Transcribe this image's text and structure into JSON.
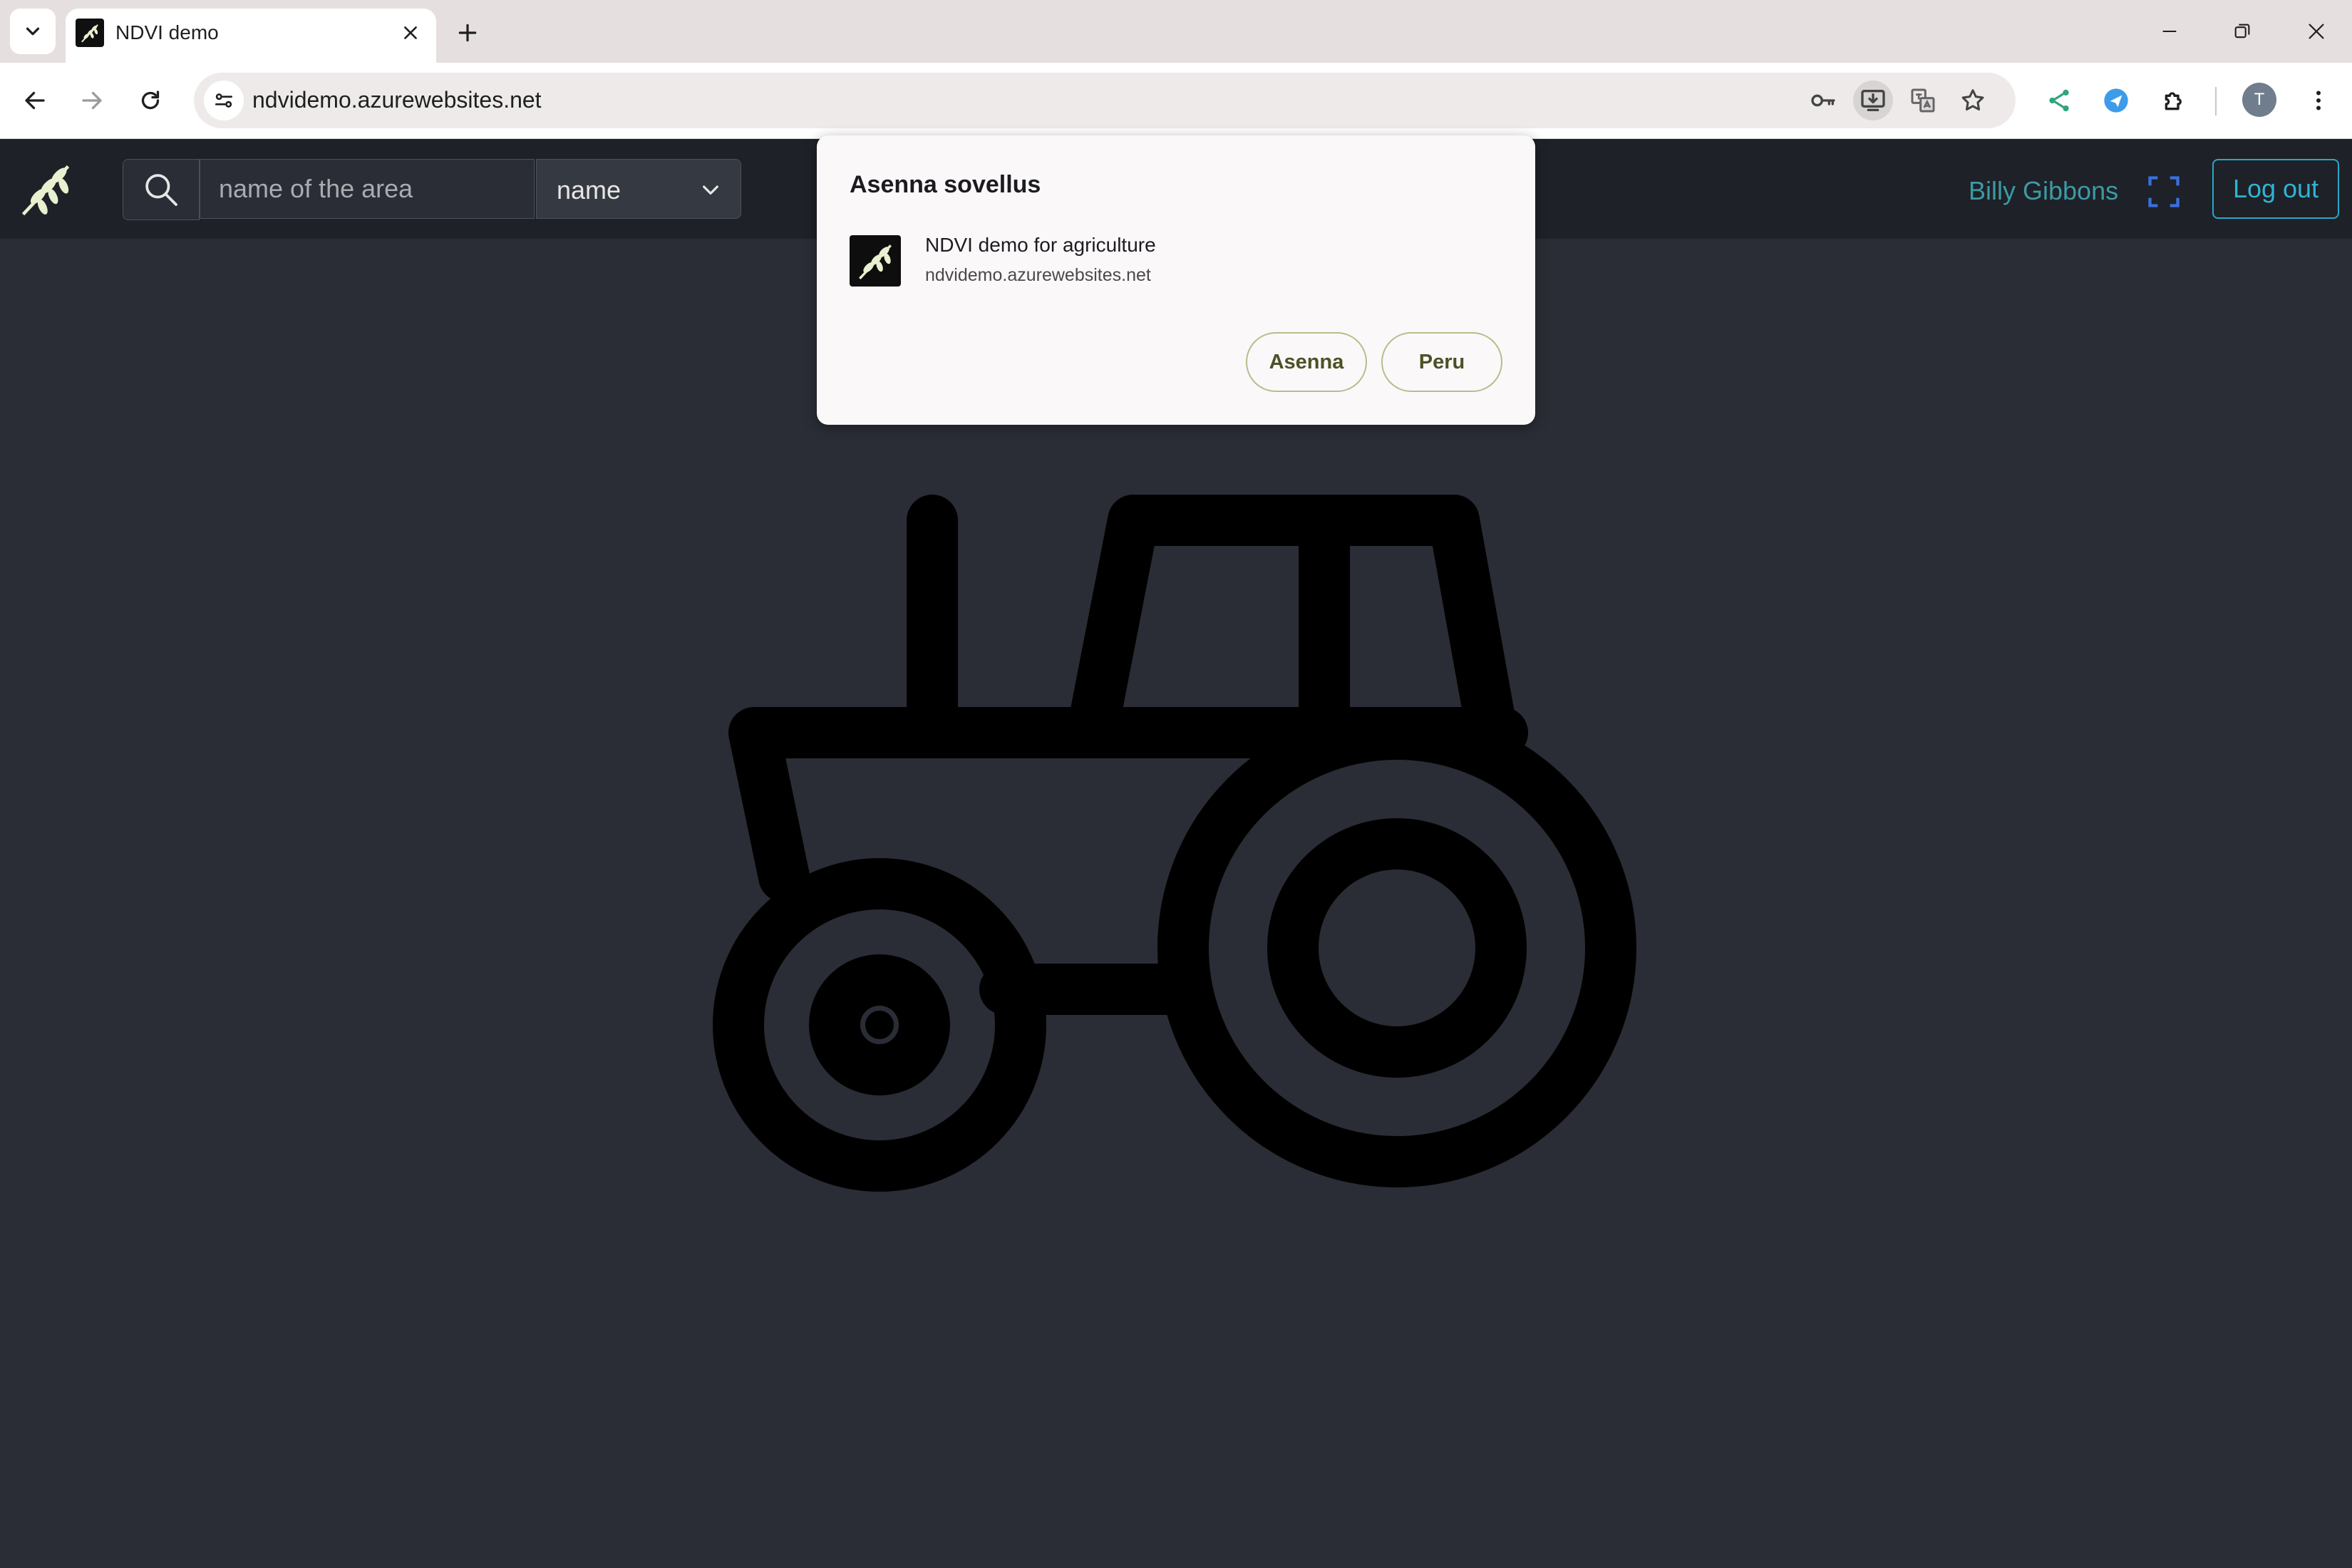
{
  "browser": {
    "tab": {
      "title": "NDVI demo"
    },
    "omnibox": {
      "url": "ndvidemo.azurewebsites.net"
    },
    "profile_initial": "T",
    "icons": [
      "tab-search-icon",
      "close-icon",
      "plus-icon",
      "minimize-icon",
      "restore-icon",
      "close-window-icon",
      "back-icon",
      "forward-icon",
      "reload-icon",
      "site-info-icon",
      "key-icon",
      "install-app-icon",
      "translate-icon",
      "star-icon",
      "share-icon",
      "extension-blue-icon",
      "puzzle-icon",
      "more-icon"
    ]
  },
  "app": {
    "search": {
      "placeholder": "name of the area"
    },
    "sort": {
      "selected": "name"
    },
    "user": {
      "name": "Billy Gibbons"
    },
    "logout_label": "Log out",
    "colors": {
      "header_bg": "#1e2127",
      "page_bg": "#2a2d35",
      "accent": "#2aa7c9",
      "user_name": "#3d9aa5"
    }
  },
  "install_dialog": {
    "title": "Asenna sovellus",
    "app_name": "NDVI demo for agriculture",
    "app_origin": "ndvidemo.azurewebsites.net",
    "install_label": "Asenna",
    "cancel_label": "Peru"
  },
  "illustration": {
    "icon": "tractor-icon"
  }
}
